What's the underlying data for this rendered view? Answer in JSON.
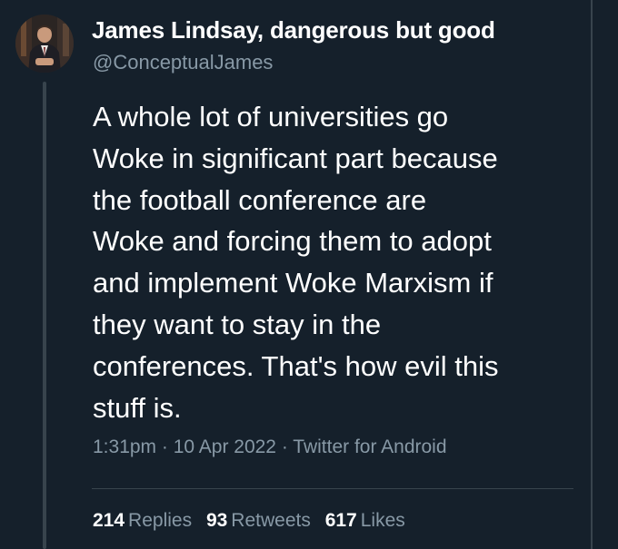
{
  "tweet": {
    "author": {
      "display_name": "James Lindsay, dangerous but good",
      "handle": "@ConceptualJames"
    },
    "text_lines": [
      "A whole lot of universities go",
      "Woke in significant part because",
      "the football conference are",
      "Woke and forcing them to adopt",
      "and implement Woke Marxism if",
      "they want to stay in the",
      "conferences. That's how evil this",
      "stuff is."
    ],
    "time": "1:31pm",
    "date": "10 Apr 2022",
    "source": "Twitter for Android",
    "separator": " · ",
    "stats": {
      "replies_count": "214",
      "replies_label": "Replies",
      "retweets_count": "93",
      "retweets_label": "Retweets",
      "likes_count": "617",
      "likes_label": "Likes"
    }
  },
  "colors": {
    "background": "#15202b",
    "primary_text": "#ffffff",
    "secondary_text": "#8899a6",
    "border": "#38444d"
  }
}
